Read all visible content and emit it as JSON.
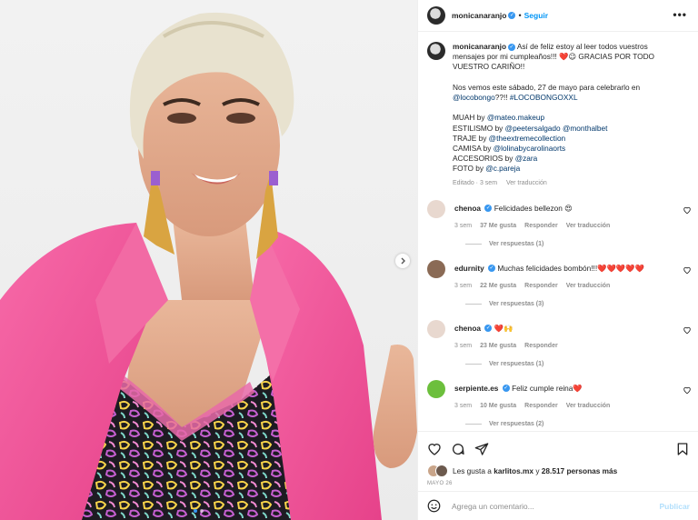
{
  "post": {
    "username": "monicanaranjo",
    "follow_label": "Seguir",
    "more_label": "•••",
    "caption_lines": [
      "Así de feliz estoy al leer todos vuestros",
      "mensajes por mi cumpleaños!!! ❤️😉 GRACIAS POR TODO",
      "VUESTRO CARIÑO!!"
    ],
    "caption_p2_a": "Nos vemos este sábado, 27 de mayo para celebrarlo en",
    "caption_p2_b_link": "@locobongo",
    "caption_p2_b_mid": "??!! ",
    "caption_p2_b_tag": "#LOCOBONGOXXL",
    "credits": [
      {
        "prefix": "MUAH by ",
        "link": "@mateo.makeup"
      },
      {
        "prefix": "ESTILISMO by ",
        "link": "@peetersalgado @monthalbet"
      },
      {
        "prefix": "TRAJE by ",
        "link": "@theextremecollection"
      },
      {
        "prefix": "CAMISA by ",
        "link": "@lolinabycarolinaorts"
      },
      {
        "prefix": "ACCESORIOS by ",
        "link": "@zara"
      },
      {
        "prefix": "FOTO by ",
        "link": "@c.pareja"
      }
    ],
    "meta_edited": "Editado · 3 sem",
    "meta_translate": "Ver traducción"
  },
  "comments": [
    {
      "user": "chenoa",
      "text": "Felicidades bellezon 😍",
      "time": "3 sem",
      "likes": "37 Me gusta",
      "reply": "Responder",
      "translate": "Ver traducción",
      "replies": "Ver respuestas (1)",
      "avatar_color": "#e8d8cf"
    },
    {
      "user": "edurnity",
      "text": "Muchas felicidades bombón!!!❤️❤️❤️❤️❤️",
      "time": "3 sem",
      "likes": "22 Me gusta",
      "reply": "Responder",
      "translate": "Ver traducción",
      "replies": "Ver respuestas (3)",
      "avatar_color": "#8a6a55"
    },
    {
      "user": "chenoa",
      "text": "❤️🙌",
      "time": "3 sem",
      "likes": "23 Me gusta",
      "reply": "Responder",
      "translate": "",
      "replies": "Ver respuestas (1)",
      "avatar_color": "#e8d8cf"
    },
    {
      "user": "serpiente.es",
      "text": "Feliz cumple reina❤️",
      "time": "3 sem",
      "likes": "10 Me gusta",
      "reply": "Responder",
      "translate": "Ver traducción",
      "replies": "Ver respuestas (2)",
      "avatar_color": "#6cbf3c"
    }
  ],
  "likes": {
    "prefix": "Les gusta a ",
    "user": "karlitos.mx",
    "middle": " y ",
    "count": "28.517 personas más"
  },
  "date": "MAYO 26",
  "comment_box": {
    "placeholder": "Agrega un comentario...",
    "publish": "Publicar"
  },
  "colors": {
    "accent": "#0095f6",
    "blazer": "#f2579a",
    "heart": "#ed4956"
  },
  "icons": [
    "heart-icon",
    "comment-icon",
    "share-icon",
    "bookmark-icon",
    "emoji-icon",
    "next-arrow-icon"
  ]
}
